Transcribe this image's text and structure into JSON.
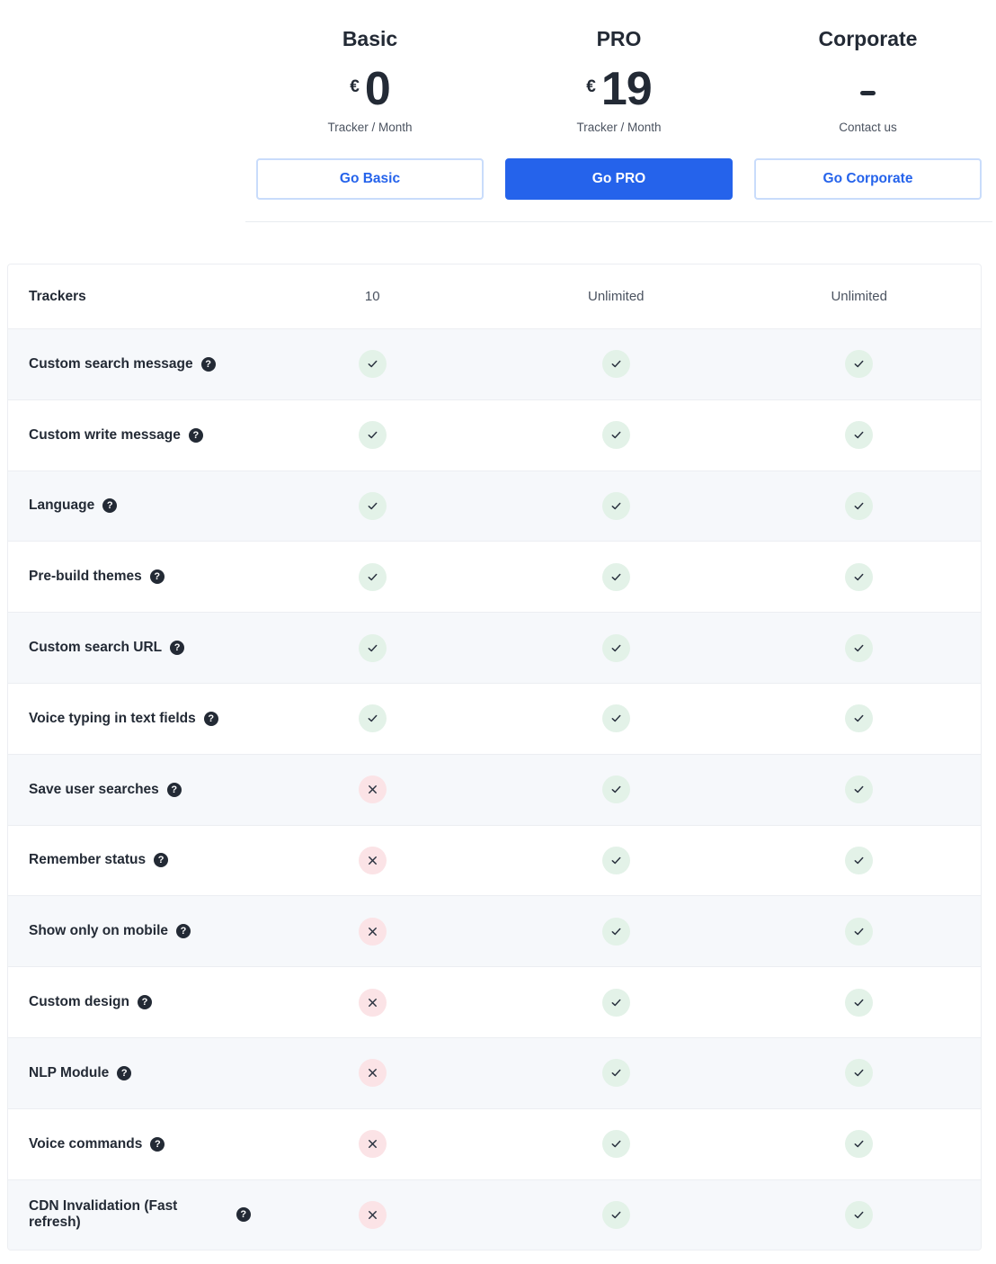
{
  "plans": [
    {
      "name": "Basic",
      "currency": "€",
      "amount": "0",
      "subtitle": "Tracker / Month",
      "button": "Go Basic",
      "style": "outline"
    },
    {
      "name": "PRO",
      "currency": "€",
      "amount": "19",
      "subtitle": "Tracker / Month",
      "button": "Go PRO",
      "style": "filled"
    },
    {
      "name": "Corporate",
      "currency": "",
      "amount": "-",
      "subtitle": "Contact us",
      "button": "Go Corporate",
      "style": "outline"
    }
  ],
  "colors": {
    "accent": "#2563eb",
    "text": "#232a35",
    "check_bg": "#e3f2e8",
    "cross_bg": "#fbe3e6",
    "alt_row_bg": "#f6f8fb"
  },
  "table": {
    "trackers": {
      "label": "Trackers",
      "values": [
        "10",
        "Unlimited",
        "Unlimited"
      ]
    },
    "help_icon": "?",
    "features": [
      {
        "label": "Custom search message",
        "values": [
          true,
          true,
          true
        ]
      },
      {
        "label": "Custom write message",
        "values": [
          true,
          true,
          true
        ]
      },
      {
        "label": "Language",
        "values": [
          true,
          true,
          true
        ]
      },
      {
        "label": "Pre-build themes",
        "values": [
          true,
          true,
          true
        ]
      },
      {
        "label": "Custom search URL",
        "values": [
          true,
          true,
          true
        ]
      },
      {
        "label": "Voice typing in text fields",
        "values": [
          true,
          true,
          true
        ]
      },
      {
        "label": "Save user searches",
        "values": [
          false,
          true,
          true
        ]
      },
      {
        "label": "Remember status",
        "values": [
          false,
          true,
          true
        ]
      },
      {
        "label": "Show only on mobile",
        "values": [
          false,
          true,
          true
        ]
      },
      {
        "label": "Custom design",
        "values": [
          false,
          true,
          true
        ]
      },
      {
        "label": "NLP Module",
        "values": [
          false,
          true,
          true
        ]
      },
      {
        "label": "Voice commands",
        "values": [
          false,
          true,
          true
        ]
      },
      {
        "label": "CDN Invalidation (Fast refresh)",
        "values": [
          false,
          true,
          true
        ]
      }
    ]
  }
}
